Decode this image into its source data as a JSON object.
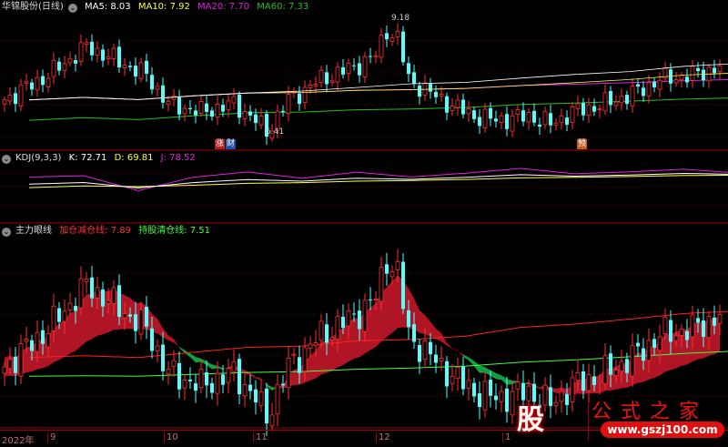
{
  "main_panel": {
    "stock_name": "华锦股份(日线)",
    "ma5": "MA5: 8.03",
    "ma10": "MA10: 7.92",
    "ma20": "MA20: 7.70",
    "ma60": "MA60: 7.33",
    "high_label": "9.18",
    "low_label": "6.41",
    "markers": [
      "涨",
      "财",
      "预"
    ]
  },
  "kdj_panel": {
    "title": "KDJ(9,3,3)",
    "k": "K: 72.71",
    "d": "D: 69.81",
    "j": "J: 78.52"
  },
  "indicator_panel": {
    "title": "主力眼线",
    "line1": "加仓减仓线: 7.89",
    "line2": "持股清仓线: 7.51"
  },
  "time_axis": [
    "2022年",
    "9",
    "10",
    "11",
    "12",
    "1"
  ],
  "watermark": {
    "logo": "股",
    "title": "公式之家",
    "url": "www.gszj100.com"
  },
  "colors": {
    "up": "#ff3030",
    "down": "#54ffff",
    "ma5": "#ffffff",
    "ma10": "#ffff40",
    "ma20": "#e020e0",
    "ma60": "#20c020",
    "fill_up": "#b01525",
    "fill_down": "#10a040"
  },
  "price_keypoints": [
    [
      0,
      7.3
    ],
    [
      8,
      7.9
    ],
    [
      15,
      8.6
    ],
    [
      20,
      8.3
    ],
    [
      26,
      7.9
    ],
    [
      30,
      7.2
    ],
    [
      36,
      7.0
    ],
    [
      42,
      7.2
    ],
    [
      46,
      6.8
    ],
    [
      48,
      6.5
    ],
    [
      52,
      7.3
    ],
    [
      58,
      7.8
    ],
    [
      64,
      8.1
    ],
    [
      68,
      8.4
    ],
    [
      70,
      9.0
    ],
    [
      72,
      8.8
    ],
    [
      74,
      7.8
    ],
    [
      80,
      7.3
    ],
    [
      86,
      6.9
    ],
    [
      90,
      6.8
    ],
    [
      96,
      6.9
    ],
    [
      100,
      6.7
    ],
    [
      104,
      7.0
    ],
    [
      110,
      7.2
    ],
    [
      116,
      7.5
    ],
    [
      120,
      7.8
    ],
    [
      126,
      7.9
    ],
    [
      131,
      8.1
    ]
  ]
}
